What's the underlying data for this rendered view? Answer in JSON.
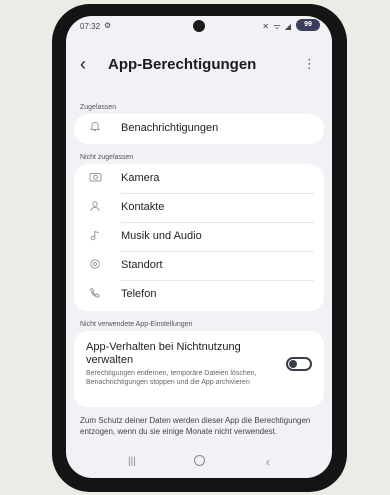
{
  "status_bar": {
    "time": "07:32",
    "settings_icon": "gear-icon",
    "indicators": "✕ ᯤ ◢",
    "battery": "99"
  },
  "app_bar": {
    "back_icon": "‹",
    "title": "App-Berechtigungen",
    "more_icon": "⋮"
  },
  "allowed": {
    "label": "Zugelassen",
    "items": [
      {
        "label": "Benachrichtigungen",
        "icon": "bell-icon"
      }
    ]
  },
  "not_allowed": {
    "label": "Nicht zugelassen",
    "items": [
      {
        "label": "Kamera",
        "icon": "camera-icon"
      },
      {
        "label": "Kontakte",
        "icon": "person-icon"
      },
      {
        "label": "Musik und Audio",
        "icon": "music-note-icon"
      },
      {
        "label": "Standort",
        "icon": "location-icon"
      },
      {
        "label": "Telefon",
        "icon": "phone-icon"
      }
    ]
  },
  "unused": {
    "label": "Nicht verwendete App-Einstellungen",
    "title": "App-Verhalten bei Nichtnutzung verwalten",
    "description": "Berechtigungen entfernen, temporäre Dateien löschen, Benachrichtigungen stoppen und die App archivieren",
    "toggle_on": false
  },
  "footnote": "Zum Schutz deiner Daten werden dieser App die Berechtigungen entzogen, wenn du sie einige Monate nicht verwendest.",
  "nav_bar": {
    "recents": "|||",
    "back": "‹"
  }
}
